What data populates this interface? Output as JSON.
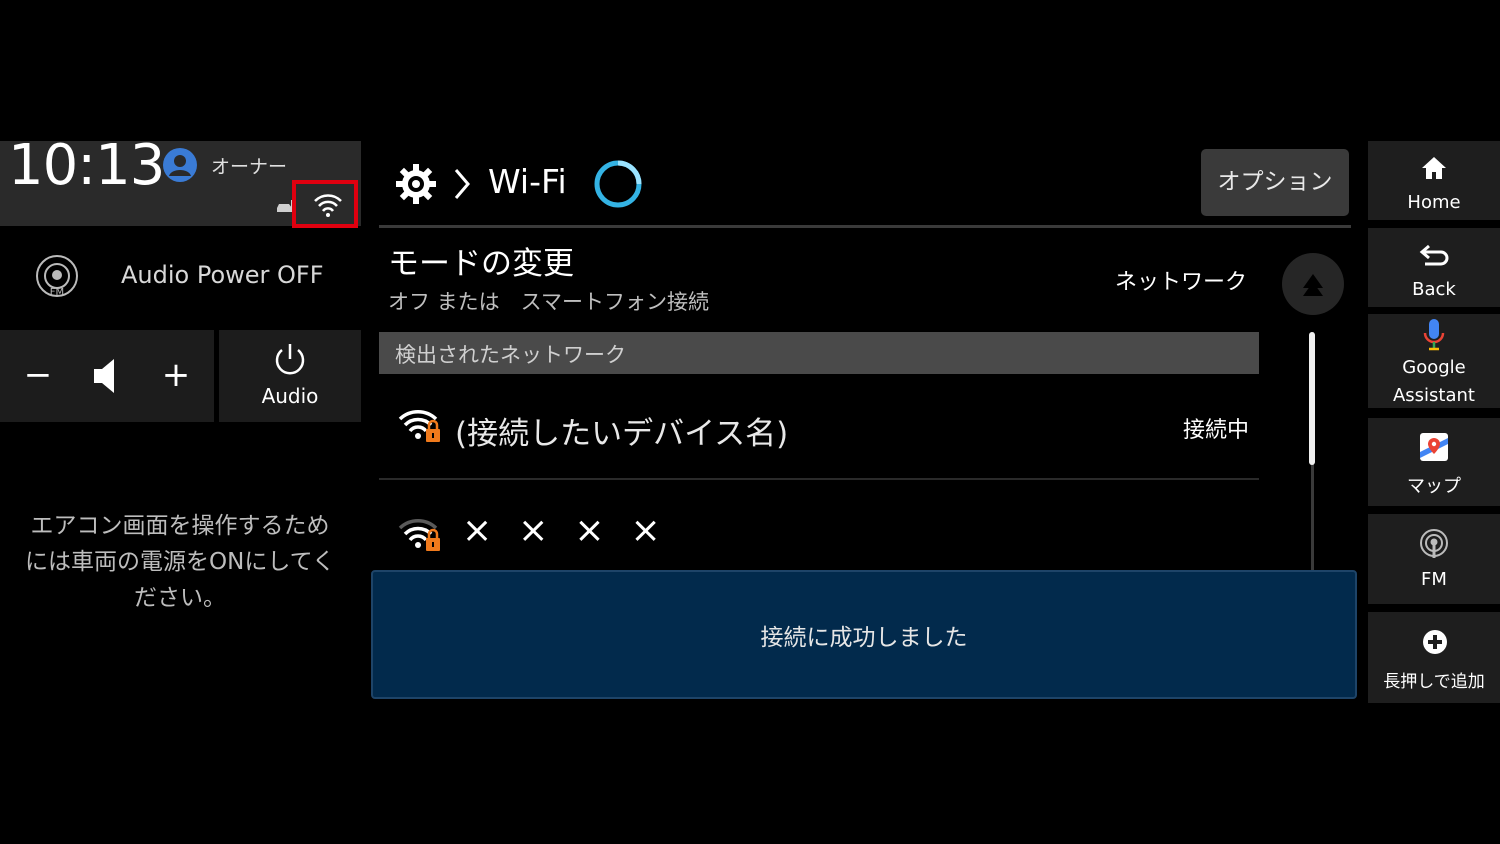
{
  "status_bar": {
    "time": "10:13",
    "user_label": "オーナー",
    "icons": [
      "user-icon",
      "car-icon",
      "wifi-icon"
    ]
  },
  "audio": {
    "source_icon": "fm-radio-icon",
    "power_text": "Audio Power OFF",
    "volume_minus": "−",
    "volume_plus": "+",
    "audio_button_label": "Audio"
  },
  "climate": {
    "message": "エアコン画面を操作するためには車両の電源をONにしてください。"
  },
  "header": {
    "breadcrumb_icon": "gear-icon",
    "title": "Wi-Fi",
    "options_label": "オプション"
  },
  "mode": {
    "title": "モードの変更",
    "subtitle": "オフ または　スマートフォン接続",
    "value": "ネットワーク"
  },
  "networks": {
    "section_label": "検出されたネットワーク",
    "items": [
      {
        "name": "(接続したいデバイス名)",
        "status": "接続中",
        "icon": "wifi-locked-icon"
      },
      {
        "name": "××××",
        "status": "",
        "icon": "wifi-locked-icon"
      }
    ]
  },
  "toast": {
    "message": "接続に成功しました"
  },
  "dock": {
    "items": [
      {
        "label": "Home",
        "icon": "home-icon"
      },
      {
        "label": "Back",
        "icon": "back-icon"
      },
      {
        "label": "Google\nAssistant",
        "icon": "microphone-icon"
      },
      {
        "label": "マップ",
        "icon": "map-icon"
      },
      {
        "label": "FM",
        "icon": "fm-radio-icon"
      },
      {
        "label": "長押しで追加",
        "icon": "add-icon"
      }
    ]
  },
  "colors": {
    "highlight": "#e0000f",
    "toast_bg": "#022a4c",
    "lock": "#f07a1c",
    "ring": "#34b3e4"
  }
}
